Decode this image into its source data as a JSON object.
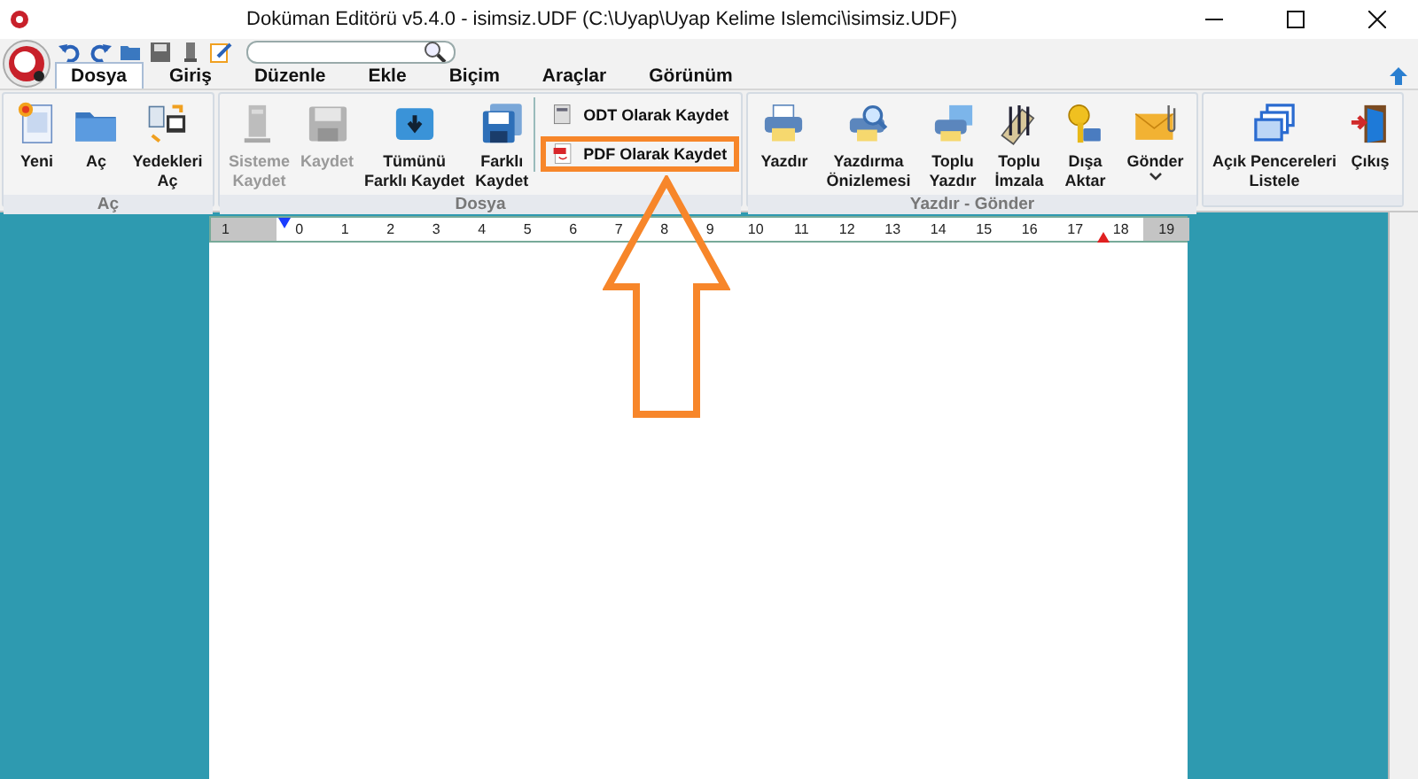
{
  "window": {
    "title": "Doküman Editörü v5.4.0 - isimsiz.UDF (C:\\Uyap\\Uyap Kelime Islemci\\isimsiz.UDF)"
  },
  "tabs": [
    {
      "label": "Dosya",
      "selected": true
    },
    {
      "label": "Giriş",
      "selected": false
    },
    {
      "label": "Düzenle",
      "selected": false
    },
    {
      "label": "Ekle",
      "selected": false
    },
    {
      "label": "Biçim",
      "selected": false
    },
    {
      "label": "Araçlar",
      "selected": false
    },
    {
      "label": "Görünüm",
      "selected": false
    }
  ],
  "ribbon": {
    "groups": [
      {
        "label": "Aç",
        "buttons": [
          {
            "kind": "large",
            "label": "Yeni",
            "disabled": false,
            "dropdown": false,
            "highlighted": false
          },
          {
            "kind": "large",
            "label": "Aç",
            "disabled": false,
            "dropdown": false,
            "highlighted": false
          },
          {
            "kind": "large",
            "label": "Yedekleri\nAç",
            "disabled": false,
            "dropdown": false,
            "highlighted": false
          }
        ]
      },
      {
        "label": "Dosya",
        "buttons": [
          {
            "kind": "large",
            "label": "Sisteme\nKaydet",
            "disabled": true,
            "dropdown": false,
            "highlighted": false
          },
          {
            "kind": "large",
            "label": "Kaydet",
            "disabled": true,
            "dropdown": false,
            "highlighted": false
          },
          {
            "kind": "large",
            "label": "Tümünü\nFarklı Kaydet",
            "disabled": false,
            "dropdown": false,
            "highlighted": false
          },
          {
            "kind": "large",
            "label": "Farklı\nKaydet",
            "disabled": false,
            "dropdown": false,
            "highlighted": false
          },
          {
            "kind": "small",
            "label": "ODT Olarak Kaydet",
            "disabled": false,
            "dropdown": false,
            "highlighted": false
          },
          {
            "kind": "small",
            "label": "PDF Olarak Kaydet",
            "disabled": false,
            "dropdown": false,
            "highlighted": true
          }
        ]
      },
      {
        "label": "Yazdır - Gönder",
        "buttons": [
          {
            "kind": "large",
            "label": "Yazdır",
            "disabled": false,
            "dropdown": false,
            "highlighted": false
          },
          {
            "kind": "large",
            "label": "Yazdırma\nÖnizlemesi",
            "disabled": false,
            "dropdown": false,
            "highlighted": false
          },
          {
            "kind": "large",
            "label": "Toplu\nYazdır",
            "disabled": false,
            "dropdown": false,
            "highlighted": false
          },
          {
            "kind": "large",
            "label": "Toplu\nİmzala",
            "disabled": false,
            "dropdown": false,
            "highlighted": false
          },
          {
            "kind": "large",
            "label": "Dışa\nAktar",
            "disabled": false,
            "dropdown": false,
            "highlighted": false
          },
          {
            "kind": "large",
            "label": "Gönder",
            "disabled": false,
            "dropdown": true,
            "highlighted": false
          }
        ]
      },
      {
        "buttons": [
          {
            "kind": "large",
            "label": "Açık Pencereleri\nListele",
            "disabled": false,
            "dropdown": false,
            "highlighted": false
          },
          {
            "kind": "large",
            "label": "Çıkış",
            "disabled": false,
            "dropdown": false,
            "highlighted": false
          }
        ]
      }
    ]
  },
  "ruler": {
    "labels": [
      {
        "text": "1",
        "margin": true
      },
      {
        "text": "0",
        "margin": false
      },
      {
        "text": "1",
        "margin": false
      },
      {
        "text": "2",
        "margin": false
      },
      {
        "text": "3",
        "margin": false
      },
      {
        "text": "4",
        "margin": false
      },
      {
        "text": "5",
        "margin": false
      },
      {
        "text": "6",
        "margin": false
      },
      {
        "text": "7",
        "margin": false
      },
      {
        "text": "8",
        "margin": false
      },
      {
        "text": "9",
        "margin": false
      },
      {
        "text": "10",
        "margin": false
      },
      {
        "text": "11",
        "margin": false
      },
      {
        "text": "12",
        "margin": false
      },
      {
        "text": "13",
        "margin": false
      },
      {
        "text": "14",
        "margin": false
      },
      {
        "text": "15",
        "margin": false
      },
      {
        "text": "16",
        "margin": false
      },
      {
        "text": "17",
        "margin": false
      },
      {
        "text": "18",
        "margin": false
      },
      {
        "text": "19",
        "margin": true
      }
    ]
  }
}
